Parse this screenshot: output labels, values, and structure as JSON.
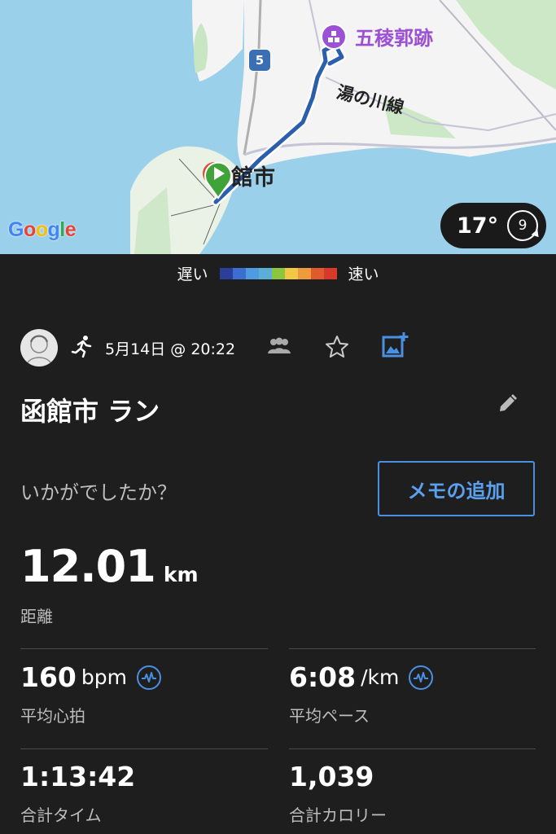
{
  "map": {
    "poi_label": "五稜郭跡",
    "route_label": "湯の川線",
    "city_label": "館市",
    "highway_number": "5",
    "google_logo": "Google",
    "temperature": "17°",
    "wind_speed": "9"
  },
  "legend": {
    "slow": "遅い",
    "fast": "速い"
  },
  "activity": {
    "date": "5月14日 @ 20:22",
    "title": "函館市 ラン",
    "prompt": "いかがでしたか？",
    "memo_button": "メモの追加"
  },
  "distance": {
    "value": "12.01",
    "unit": "km",
    "label": "距離"
  },
  "stats": [
    {
      "value": "160",
      "unit": "bpm",
      "label": "平均心拍",
      "icon": "heart-rate-chart-icon"
    },
    {
      "value": "6:08",
      "unit": "/km",
      "label": "平均ペース",
      "icon": "pace-chart-icon"
    },
    {
      "value": "1:13:42",
      "unit": "",
      "label": "合計タイム"
    },
    {
      "value": "1,039",
      "unit": "",
      "label": "合計カロリー"
    }
  ],
  "colors": {
    "accent": "#4a90e2",
    "background": "#1e1e1e",
    "poi": "#9b50d6",
    "water": "#9bd0ea",
    "route": "#2b5fae",
    "legend": [
      "#2a3f9a",
      "#3a6fd1",
      "#4f9ae0",
      "#5aaed8",
      "#8cc63f",
      "#f2c744",
      "#f09a3e",
      "#e05a2e",
      "#d83a2a"
    ]
  }
}
